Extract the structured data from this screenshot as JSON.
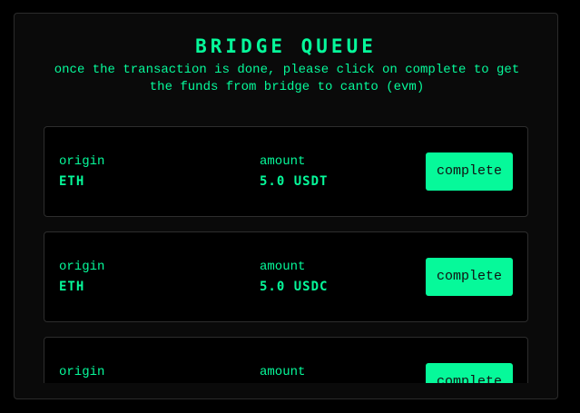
{
  "header": {
    "title": "BRIDGE QUEUE",
    "subtitle": "once the transaction is done, please click on complete to get the funds from bridge to canto (evm)"
  },
  "queue": {
    "items": [
      {
        "origin_label": "origin",
        "origin_value": "ETH",
        "amount_label": "amount",
        "amount_value": "5.0 USDT",
        "button_label": "complete"
      },
      {
        "origin_label": "origin",
        "origin_value": "ETH",
        "amount_label": "amount",
        "amount_value": "5.0 USDC",
        "button_label": "complete"
      },
      {
        "origin_label": "origin",
        "amount_label": "amount",
        "button_label": "complete"
      }
    ]
  },
  "colors": {
    "accent": "#06f99a",
    "page_background": "#000000",
    "panel_background": "#0a0a0a",
    "card_border": "#2d2d2d"
  }
}
